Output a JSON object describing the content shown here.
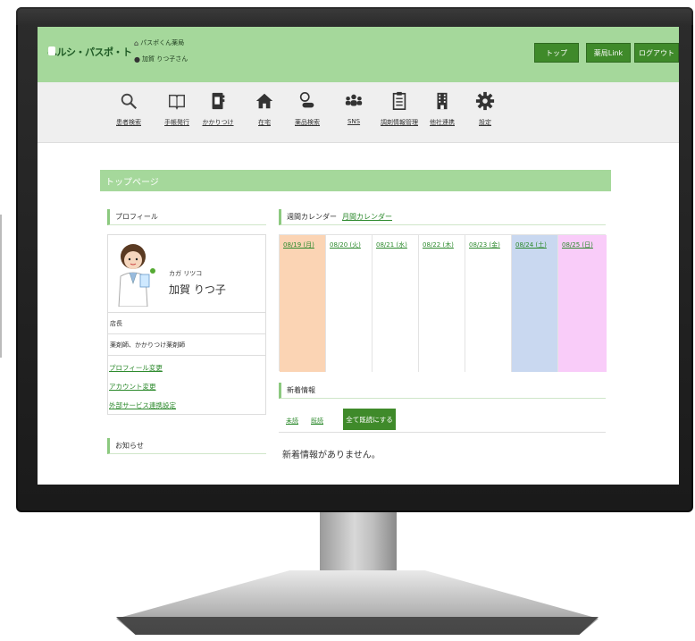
{
  "header": {
    "logo_text": "ヘルシ・パスポ・ト",
    "pharmacy": "パスポくん薬局",
    "user": "加賀 りつ子さん",
    "buttons": [
      "トップ",
      "薬局Link",
      "ログアウト"
    ],
    "accent": "#a5d89b",
    "button_color": "#3f8a2a"
  },
  "toolbar": {
    "items": [
      {
        "label": "患者検索",
        "icon": "search-icon"
      },
      {
        "label": "手帳発行",
        "icon": "book-icon"
      },
      {
        "label": "かかりつけ",
        "icon": "phone-book-icon"
      },
      {
        "label": "在宅",
        "icon": "home-icon"
      },
      {
        "label": "薬品検索",
        "icon": "medicine-icon"
      },
      {
        "label": "SNS",
        "icon": "people-icon"
      },
      {
        "label": "調剤情報管理",
        "icon": "clipboard-icon"
      },
      {
        "label": "他社連携",
        "icon": "building-icon"
      },
      {
        "label": "設定",
        "icon": "gear-icon"
      }
    ]
  },
  "main": {
    "page_title": "トップページ",
    "profile": {
      "heading": "プロフィール",
      "kana": "カガ リツコ",
      "name": "加賀 りつ子",
      "role": "店長",
      "qualification": "薬剤師、かかりつけ薬剤師",
      "links": [
        "プロフィール変更",
        "アカウント変更",
        "外部サービス連携設定"
      ]
    },
    "notice_heading": "お知らせ",
    "calendar": {
      "heading": "週間カレンダー",
      "monthly_link": "月間カレンダー",
      "days": [
        {
          "label": "08/19 (月)",
          "color": "#fbd4b4"
        },
        {
          "label": "08/20 (火)",
          "color": "#ffffff"
        },
        {
          "label": "08/21 (水)",
          "color": "#ffffff"
        },
        {
          "label": "08/22 (木)",
          "color": "#ffffff"
        },
        {
          "label": "08/23 (金)",
          "color": "#ffffff"
        },
        {
          "label": "08/24 (土)",
          "color": "#c9d8f0"
        },
        {
          "label": "08/25 (日)",
          "color": "#f9ccf9"
        }
      ]
    },
    "news": {
      "heading": "新着情報",
      "tab_unread": "未読",
      "tab_read": "既読",
      "mark_all_button": "全て既読にする",
      "empty_message": "新着情報がありません。"
    }
  }
}
